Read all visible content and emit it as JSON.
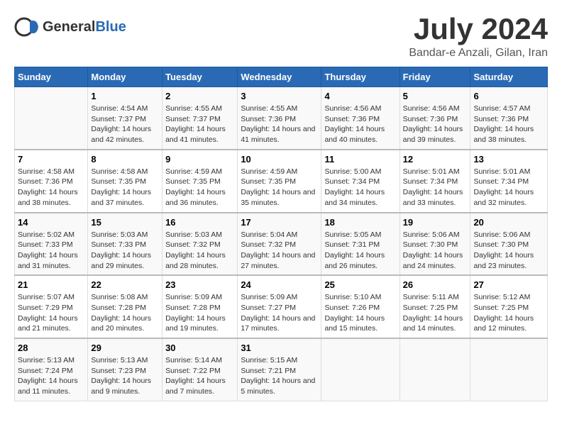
{
  "header": {
    "logo_general": "General",
    "logo_blue": "Blue",
    "month_year": "July 2024",
    "location": "Bandar-e Anzali, Gilan, Iran"
  },
  "columns": [
    "Sunday",
    "Monday",
    "Tuesday",
    "Wednesday",
    "Thursday",
    "Friday",
    "Saturday"
  ],
  "weeks": [
    [
      {
        "day": "",
        "sunrise": "",
        "sunset": "",
        "daylight": ""
      },
      {
        "day": "1",
        "sunrise": "Sunrise: 4:54 AM",
        "sunset": "Sunset: 7:37 PM",
        "daylight": "Daylight: 14 hours and 42 minutes."
      },
      {
        "day": "2",
        "sunrise": "Sunrise: 4:55 AM",
        "sunset": "Sunset: 7:37 PM",
        "daylight": "Daylight: 14 hours and 41 minutes."
      },
      {
        "day": "3",
        "sunrise": "Sunrise: 4:55 AM",
        "sunset": "Sunset: 7:36 PM",
        "daylight": "Daylight: 14 hours and 41 minutes."
      },
      {
        "day": "4",
        "sunrise": "Sunrise: 4:56 AM",
        "sunset": "Sunset: 7:36 PM",
        "daylight": "Daylight: 14 hours and 40 minutes."
      },
      {
        "day": "5",
        "sunrise": "Sunrise: 4:56 AM",
        "sunset": "Sunset: 7:36 PM",
        "daylight": "Daylight: 14 hours and 39 minutes."
      },
      {
        "day": "6",
        "sunrise": "Sunrise: 4:57 AM",
        "sunset": "Sunset: 7:36 PM",
        "daylight": "Daylight: 14 hours and 38 minutes."
      }
    ],
    [
      {
        "day": "7",
        "sunrise": "Sunrise: 4:58 AM",
        "sunset": "Sunset: 7:36 PM",
        "daylight": "Daylight: 14 hours and 38 minutes."
      },
      {
        "day": "8",
        "sunrise": "Sunrise: 4:58 AM",
        "sunset": "Sunset: 7:35 PM",
        "daylight": "Daylight: 14 hours and 37 minutes."
      },
      {
        "day": "9",
        "sunrise": "Sunrise: 4:59 AM",
        "sunset": "Sunset: 7:35 PM",
        "daylight": "Daylight: 14 hours and 36 minutes."
      },
      {
        "day": "10",
        "sunrise": "Sunrise: 4:59 AM",
        "sunset": "Sunset: 7:35 PM",
        "daylight": "Daylight: 14 hours and 35 minutes."
      },
      {
        "day": "11",
        "sunrise": "Sunrise: 5:00 AM",
        "sunset": "Sunset: 7:34 PM",
        "daylight": "Daylight: 14 hours and 34 minutes."
      },
      {
        "day": "12",
        "sunrise": "Sunrise: 5:01 AM",
        "sunset": "Sunset: 7:34 PM",
        "daylight": "Daylight: 14 hours and 33 minutes."
      },
      {
        "day": "13",
        "sunrise": "Sunrise: 5:01 AM",
        "sunset": "Sunset: 7:34 PM",
        "daylight": "Daylight: 14 hours and 32 minutes."
      }
    ],
    [
      {
        "day": "14",
        "sunrise": "Sunrise: 5:02 AM",
        "sunset": "Sunset: 7:33 PM",
        "daylight": "Daylight: 14 hours and 31 minutes."
      },
      {
        "day": "15",
        "sunrise": "Sunrise: 5:03 AM",
        "sunset": "Sunset: 7:33 PM",
        "daylight": "Daylight: 14 hours and 29 minutes."
      },
      {
        "day": "16",
        "sunrise": "Sunrise: 5:03 AM",
        "sunset": "Sunset: 7:32 PM",
        "daylight": "Daylight: 14 hours and 28 minutes."
      },
      {
        "day": "17",
        "sunrise": "Sunrise: 5:04 AM",
        "sunset": "Sunset: 7:32 PM",
        "daylight": "Daylight: 14 hours and 27 minutes."
      },
      {
        "day": "18",
        "sunrise": "Sunrise: 5:05 AM",
        "sunset": "Sunset: 7:31 PM",
        "daylight": "Daylight: 14 hours and 26 minutes."
      },
      {
        "day": "19",
        "sunrise": "Sunrise: 5:06 AM",
        "sunset": "Sunset: 7:30 PM",
        "daylight": "Daylight: 14 hours and 24 minutes."
      },
      {
        "day": "20",
        "sunrise": "Sunrise: 5:06 AM",
        "sunset": "Sunset: 7:30 PM",
        "daylight": "Daylight: 14 hours and 23 minutes."
      }
    ],
    [
      {
        "day": "21",
        "sunrise": "Sunrise: 5:07 AM",
        "sunset": "Sunset: 7:29 PM",
        "daylight": "Daylight: 14 hours and 21 minutes."
      },
      {
        "day": "22",
        "sunrise": "Sunrise: 5:08 AM",
        "sunset": "Sunset: 7:28 PM",
        "daylight": "Daylight: 14 hours and 20 minutes."
      },
      {
        "day": "23",
        "sunrise": "Sunrise: 5:09 AM",
        "sunset": "Sunset: 7:28 PM",
        "daylight": "Daylight: 14 hours and 19 minutes."
      },
      {
        "day": "24",
        "sunrise": "Sunrise: 5:09 AM",
        "sunset": "Sunset: 7:27 PM",
        "daylight": "Daylight: 14 hours and 17 minutes."
      },
      {
        "day": "25",
        "sunrise": "Sunrise: 5:10 AM",
        "sunset": "Sunset: 7:26 PM",
        "daylight": "Daylight: 14 hours and 15 minutes."
      },
      {
        "day": "26",
        "sunrise": "Sunrise: 5:11 AM",
        "sunset": "Sunset: 7:25 PM",
        "daylight": "Daylight: 14 hours and 14 minutes."
      },
      {
        "day": "27",
        "sunrise": "Sunrise: 5:12 AM",
        "sunset": "Sunset: 7:25 PM",
        "daylight": "Daylight: 14 hours and 12 minutes."
      }
    ],
    [
      {
        "day": "28",
        "sunrise": "Sunrise: 5:13 AM",
        "sunset": "Sunset: 7:24 PM",
        "daylight": "Daylight: 14 hours and 11 minutes."
      },
      {
        "day": "29",
        "sunrise": "Sunrise: 5:13 AM",
        "sunset": "Sunset: 7:23 PM",
        "daylight": "Daylight: 14 hours and 9 minutes."
      },
      {
        "day": "30",
        "sunrise": "Sunrise: 5:14 AM",
        "sunset": "Sunset: 7:22 PM",
        "daylight": "Daylight: 14 hours and 7 minutes."
      },
      {
        "day": "31",
        "sunrise": "Sunrise: 5:15 AM",
        "sunset": "Sunset: 7:21 PM",
        "daylight": "Daylight: 14 hours and 5 minutes."
      },
      {
        "day": "",
        "sunrise": "",
        "sunset": "",
        "daylight": ""
      },
      {
        "day": "",
        "sunrise": "",
        "sunset": "",
        "daylight": ""
      },
      {
        "day": "",
        "sunrise": "",
        "sunset": "",
        "daylight": ""
      }
    ]
  ]
}
